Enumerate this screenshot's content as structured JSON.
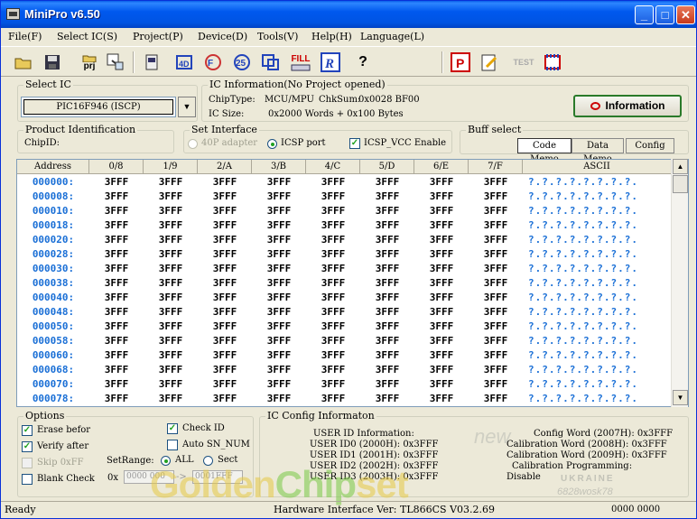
{
  "window": {
    "title": "MiniPro v6.50"
  },
  "menu": [
    "File(F)",
    "Select IC(S)",
    "Project(P)",
    "Device(D)",
    "Tools(V)",
    "Help(H)",
    "Language(L)"
  ],
  "toolbar": {
    "prj_label": "prj",
    "fill_label": "FILL",
    "test_label": "TEST",
    "help_glyph": "?"
  },
  "select_ic": {
    "title": "Select IC",
    "value": "PIC16F946 (ISCP)"
  },
  "ic_info": {
    "title": "IC Information(No Project opened)",
    "chiptype_label": "ChipType:",
    "chiptype_value": "MCU/MPU",
    "chksum_label": "ChkSum:",
    "chksum_value": "0x0028 BF00",
    "icsize_label": "IC Size:",
    "icsize_value": "0x2000 Words + 0x100 Bytes",
    "button_label": "Information"
  },
  "product_id": {
    "title": "Product Identification",
    "chipid_label": "ChipID:"
  },
  "set_interface": {
    "title": "Set Interface",
    "adapter_label": "40P adapter",
    "icsp_port_label": "ICSP port",
    "icsp_vcc_label": "ICSP_VCC Enable"
  },
  "buff_select": {
    "title": "Buff select",
    "tabs": [
      "Code Memo",
      "Data Memo",
      "Config"
    ]
  },
  "grid": {
    "headers": [
      "Address",
      "0/8",
      "1/9",
      "2/A",
      "3/B",
      "4/C",
      "5/D",
      "6/E",
      "7/F",
      "ASCII"
    ],
    "rows": [
      {
        "addr": "000000:",
        "cells": [
          "3FFF",
          "3FFF",
          "3FFF",
          "3FFF",
          "3FFF",
          "3FFF",
          "3FFF",
          "3FFF"
        ],
        "ascii": "?.?.?.?.?.?.?.?."
      },
      {
        "addr": "000008:",
        "cells": [
          "3FFF",
          "3FFF",
          "3FFF",
          "3FFF",
          "3FFF",
          "3FFF",
          "3FFF",
          "3FFF"
        ],
        "ascii": "?.?.?.?.?.?.?.?."
      },
      {
        "addr": "000010:",
        "cells": [
          "3FFF",
          "3FFF",
          "3FFF",
          "3FFF",
          "3FFF",
          "3FFF",
          "3FFF",
          "3FFF"
        ],
        "ascii": "?.?.?.?.?.?.?.?."
      },
      {
        "addr": "000018:",
        "cells": [
          "3FFF",
          "3FFF",
          "3FFF",
          "3FFF",
          "3FFF",
          "3FFF",
          "3FFF",
          "3FFF"
        ],
        "ascii": "?.?.?.?.?.?.?.?."
      },
      {
        "addr": "000020:",
        "cells": [
          "3FFF",
          "3FFF",
          "3FFF",
          "3FFF",
          "3FFF",
          "3FFF",
          "3FFF",
          "3FFF"
        ],
        "ascii": "?.?.?.?.?.?.?.?."
      },
      {
        "addr": "000028:",
        "cells": [
          "3FFF",
          "3FFF",
          "3FFF",
          "3FFF",
          "3FFF",
          "3FFF",
          "3FFF",
          "3FFF"
        ],
        "ascii": "?.?.?.?.?.?.?.?."
      },
      {
        "addr": "000030:",
        "cells": [
          "3FFF",
          "3FFF",
          "3FFF",
          "3FFF",
          "3FFF",
          "3FFF",
          "3FFF",
          "3FFF"
        ],
        "ascii": "?.?.?.?.?.?.?.?."
      },
      {
        "addr": "000038:",
        "cells": [
          "3FFF",
          "3FFF",
          "3FFF",
          "3FFF",
          "3FFF",
          "3FFF",
          "3FFF",
          "3FFF"
        ],
        "ascii": "?.?.?.?.?.?.?.?."
      },
      {
        "addr": "000040:",
        "cells": [
          "3FFF",
          "3FFF",
          "3FFF",
          "3FFF",
          "3FFF",
          "3FFF",
          "3FFF",
          "3FFF"
        ],
        "ascii": "?.?.?.?.?.?.?.?."
      },
      {
        "addr": "000048:",
        "cells": [
          "3FFF",
          "3FFF",
          "3FFF",
          "3FFF",
          "3FFF",
          "3FFF",
          "3FFF",
          "3FFF"
        ],
        "ascii": "?.?.?.?.?.?.?.?."
      },
      {
        "addr": "000050:",
        "cells": [
          "3FFF",
          "3FFF",
          "3FFF",
          "3FFF",
          "3FFF",
          "3FFF",
          "3FFF",
          "3FFF"
        ],
        "ascii": "?.?.?.?.?.?.?.?."
      },
      {
        "addr": "000058:",
        "cells": [
          "3FFF",
          "3FFF",
          "3FFF",
          "3FFF",
          "3FFF",
          "3FFF",
          "3FFF",
          "3FFF"
        ],
        "ascii": "?.?.?.?.?.?.?.?."
      },
      {
        "addr": "000060:",
        "cells": [
          "3FFF",
          "3FFF",
          "3FFF",
          "3FFF",
          "3FFF",
          "3FFF",
          "3FFF",
          "3FFF"
        ],
        "ascii": "?.?.?.?.?.?.?.?."
      },
      {
        "addr": "000068:",
        "cells": [
          "3FFF",
          "3FFF",
          "3FFF",
          "3FFF",
          "3FFF",
          "3FFF",
          "3FFF",
          "3FFF"
        ],
        "ascii": "?.?.?.?.?.?.?.?."
      },
      {
        "addr": "000070:",
        "cells": [
          "3FFF",
          "3FFF",
          "3FFF",
          "3FFF",
          "3FFF",
          "3FFF",
          "3FFF",
          "3FFF"
        ],
        "ascii": "?.?.?.?.?.?.?.?."
      },
      {
        "addr": "000078:",
        "cells": [
          "3FFF",
          "3FFF",
          "3FFF",
          "3FFF",
          "3FFF",
          "3FFF",
          "3FFF",
          "3FFF"
        ],
        "ascii": "?.?.?.?.?.?.?.?."
      }
    ]
  },
  "options": {
    "title": "Options",
    "erase_before": "Erase befor",
    "verify_after": "Verify after",
    "skip_0xff": "Skip 0xFF",
    "blank_check": "Blank Check",
    "check_id": "Check ID",
    "auto_sn_num": "Auto SN_NUM",
    "setrange_label": "SetRange:",
    "all_label": "ALL",
    "sect_label": "Sect",
    "ox_label": "0x",
    "range_start": "0000 000",
    "range_end": "0001FFF",
    "arrow": "->"
  },
  "config": {
    "title": "IC Config Informaton",
    "left": [
      "USER ID Information:",
      "USER ID0 (2000H): 0x3FFF",
      "USER ID1 (2001H): 0x3FFF",
      "USER ID2 (2002H): 0x3FFF",
      "USER ID3 (2003H): 0x3FFF"
    ],
    "right": [
      "Config Word (2007H): 0x3FFF",
      "Calibration Word (2008H): 0x3FFF",
      "Calibration Word (2009H): 0x3FFF",
      "Calibration Programming:",
      "Disable"
    ]
  },
  "status": {
    "left": "Ready",
    "center": "Hardware Interface Ver: TL866CS V03.2.69",
    "right": "0000 0000"
  },
  "watermark": {
    "brand_a": "Golden",
    "brand_b": "Chip",
    "brand_c": "set",
    "new": "new",
    "ukraine": "UKRAINE",
    "id": "6828wosk78"
  }
}
